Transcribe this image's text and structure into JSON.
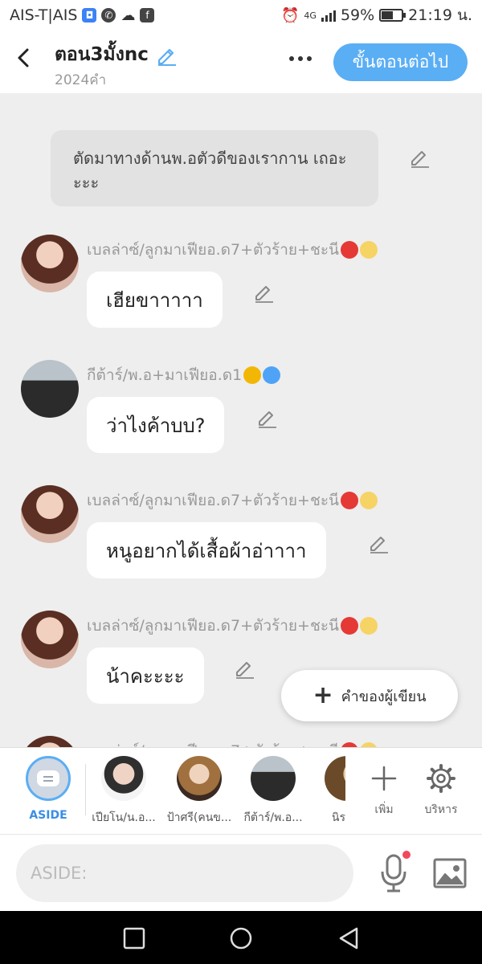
{
  "status": {
    "carrier": "AIS-T|AIS",
    "network": "4G",
    "battery": "59%",
    "battery_level": 0.59,
    "time": "21:19 น."
  },
  "header": {
    "title": "ตอน3มั้งnc",
    "word_count": "2024คำ",
    "next_button": "ขั้นตอนต่อไป"
  },
  "narration": {
    "text": "ตัดมาทางด้านพ.อตัวดีของเรากาน เถอะะะะ"
  },
  "messages": [
    {
      "name": "เบลล่าซ์/ลูกมาเฟียอ.ด7+ตัวร้าย+ชะนี",
      "text": "เฮียขาาาาา",
      "avatar": "bella"
    },
    {
      "name": "กีต้าร์/พ.อ+มาเฟียอ.ด1",
      "text": "ว่าไงค้าบบ?",
      "avatar": "guitar"
    },
    {
      "name": "เบลล่าซ์/ลูกมาเฟียอ.ด7+ตัวร้าย+ชะนี",
      "text": "หนูอยากได้เสื้อผ้าอ่าาาา",
      "avatar": "bella"
    },
    {
      "name": "เบลล่าซ์/ลูกมาเฟียอ.ด7+ตัวร้าย+ชะนี",
      "text": "น้าคะะะะ",
      "avatar": "bella"
    },
    {
      "name": "เบลล่าซ์/ลูกมาเฟียอ.ด7+ตัวร้าย+ชะนี",
      "text": "",
      "avatar": "bella"
    }
  ],
  "fab": {
    "label": "คำของผู้เขียน"
  },
  "characters": {
    "aside_label": "ASIDE",
    "items": [
      {
        "label": "เปียโน/น.อ..."
      },
      {
        "label": "ป้าศรี(คนข..."
      },
      {
        "label": "กีต้าร์/พ.อ..."
      },
      {
        "label": "นิร"
      }
    ],
    "add_label": "เพิ่ม",
    "manage_label": "บริหาร"
  },
  "composer": {
    "placeholder": "ASIDE:"
  },
  "colors": {
    "accent": "#5aaef4",
    "background": "#eeeeee"
  }
}
